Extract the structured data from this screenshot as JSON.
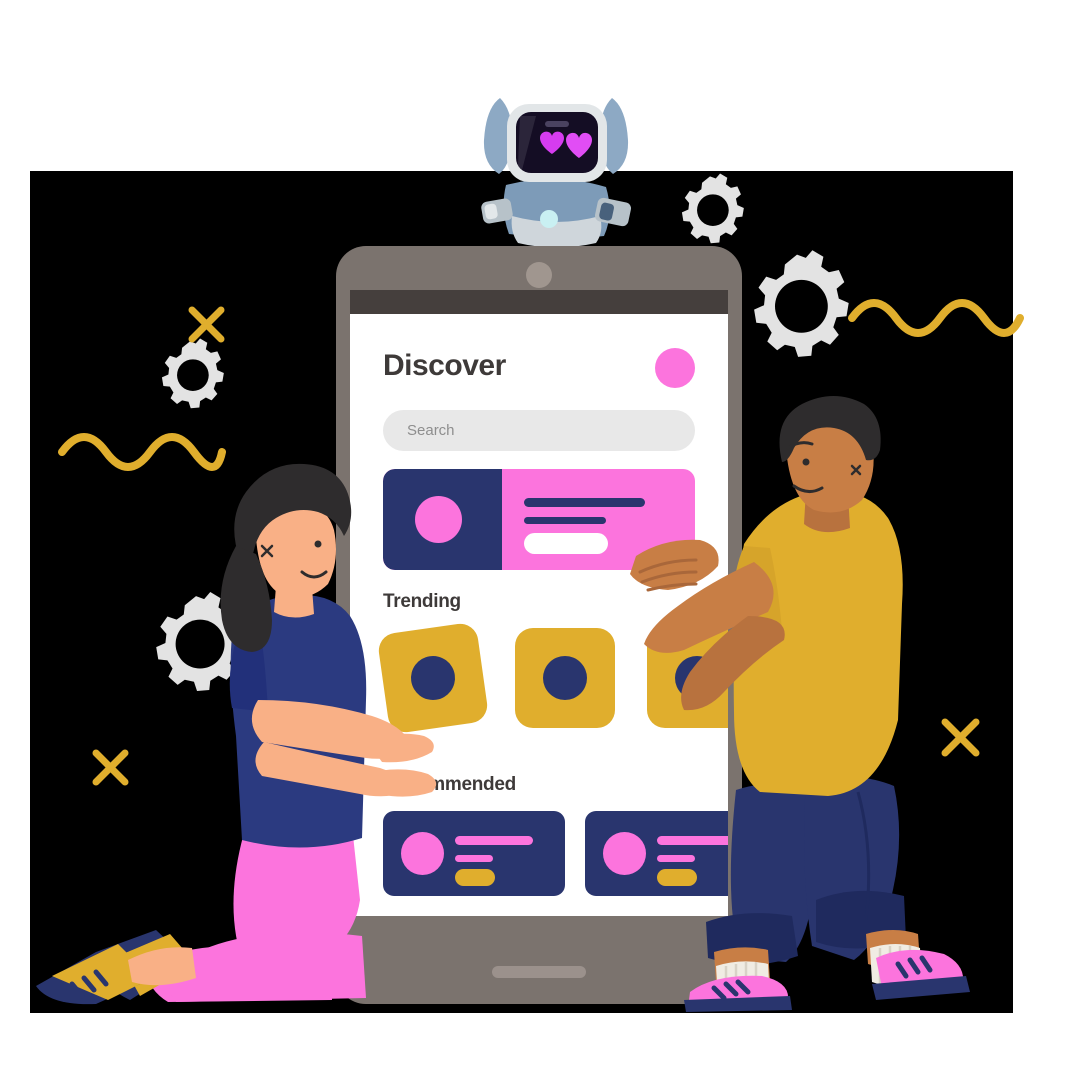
{
  "scene": {
    "title": "Discover app illustration",
    "backdrop_color": "#000000",
    "page_background": "#ffffff"
  },
  "palette": {
    "navy": "#29356e",
    "pink": "#fc74dd",
    "yellow": "#e0ae2d",
    "gray_frame": "#7b736e",
    "statusbar": "#453f3d",
    "screen_white": "#ffffff",
    "search_field": "#e8e8e8",
    "text_dark": "#3e3a39",
    "placeholder_gray": "#8e8e8e",
    "gear_gray": "#e3e3e3",
    "skin_light": "#f9b086",
    "skin_dark": "#c87e45",
    "hair_dark": "#2e2c2d"
  },
  "phone": {
    "notch": "camera-dot",
    "home_indicator": "home-bar",
    "statusbar_label": ""
  },
  "app": {
    "header": {
      "title": "Discover",
      "avatar": "user-avatar"
    },
    "search": {
      "placeholder": "Search",
      "value": ""
    },
    "hero_card": {
      "thumbnail": "hero-thumbnail",
      "line_1": "",
      "line_2": "",
      "action_pill": ""
    },
    "sections": [
      {
        "id": "trending",
        "title": "Trending",
        "tiles": [
          {
            "id": "tile-1",
            "label": ""
          },
          {
            "id": "tile-2",
            "label": ""
          },
          {
            "id": "tile-3",
            "label": ""
          }
        ]
      },
      {
        "id": "recommended",
        "title": "Recommended",
        "cards": [
          {
            "id": "rec-1",
            "title_line": "",
            "sub_line": "",
            "badge": ""
          },
          {
            "id": "rec-2",
            "title_line": "",
            "sub_line": "",
            "badge": ""
          }
        ]
      }
    ]
  },
  "characters": {
    "robot": {
      "name": "robot-mascot",
      "face_expression": "heart-eyes",
      "screen_color": "#140d24",
      "heart_color": "#d63cf0",
      "body_color": "#7d9bb8",
      "frame_color": "#d9dde0"
    },
    "woman": {
      "name": "woman-kneeling",
      "shirt_color": "#2b3a80",
      "pants_color": "#fc74dd",
      "shoe_colors": [
        "#e0ae2d",
        "#29356e"
      ],
      "hair_color": "#2e2c2d",
      "skin_color": "#f9b086"
    },
    "man": {
      "name": "man-walking",
      "shirt_color": "#e0ae2d",
      "pants_color": "#29356e",
      "shoe_colors": [
        "#fc74dd",
        "#29356e"
      ],
      "sock_color": "#f0ece3",
      "hair_color": "#2e2c2d",
      "skin_color": "#c87e45"
    }
  },
  "decorations": {
    "gears": [
      {
        "id": "gear-top-right-small",
        "color": "#e3e3e3"
      },
      {
        "id": "gear-top-right-large",
        "color": "#e3e3e3"
      },
      {
        "id": "gear-left-small",
        "color": "#e3e3e3"
      },
      {
        "id": "gear-left-large",
        "color": "#e3e3e3"
      }
    ],
    "x_marks": [
      {
        "id": "x-upper-left",
        "color": "#e0ae2d"
      },
      {
        "id": "x-lower-left",
        "color": "#e0ae2d"
      },
      {
        "id": "x-right",
        "color": "#e0ae2d"
      }
    ],
    "squiggles": [
      {
        "id": "squiggle-left",
        "color": "#e0ae2d"
      },
      {
        "id": "squiggle-right",
        "color": "#e0ae2d"
      }
    ]
  }
}
